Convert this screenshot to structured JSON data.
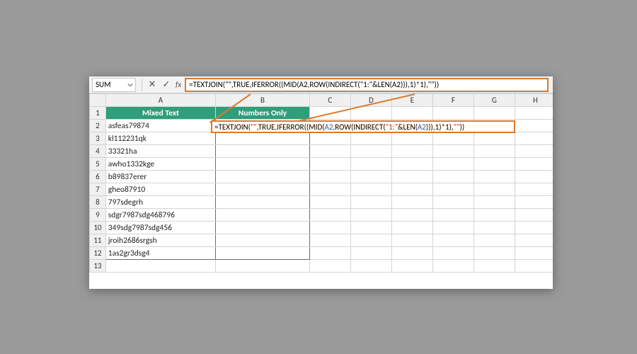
{
  "namebox": {
    "value": "SUM"
  },
  "formula_bar": {
    "cancel_glyph": "✕",
    "enter_glyph": "✓",
    "fx_label": "fx",
    "formula_plain": "=TEXTJOIN(\"\",TRUE,IFERROR((MID(A2,ROW(INDIRECT(\"1:\"&LEN(A2))),1)*1),\"\"))"
  },
  "columns": [
    "A",
    "B",
    "C",
    "D",
    "E",
    "F",
    "G",
    "H"
  ],
  "row_numbers": [
    "1",
    "2",
    "3",
    "4",
    "5",
    "6",
    "7",
    "8",
    "9",
    "10",
    "11",
    "12",
    "13"
  ],
  "headers": {
    "A": "Mixed Text",
    "B": "Numbers Only"
  },
  "col_a": {
    "r2": "asfeas79874",
    "r3": "kl112231qk",
    "r4": "33321ha",
    "r5": "awho1332kge",
    "r6": "b89837erer",
    "r7": "gheo87910",
    "r8": "797sdegrh",
    "r9": "sdgr7987sdg468796",
    "r10": "349sdg7987sdg456",
    "r11": "jroih2686srgsh",
    "r12": "1as2gr3dsg4"
  },
  "cell_edit": {
    "p1": "=TEXTJOIN(",
    "p2": "\"\"",
    "p3": ",TRUE,IFERROR((MID(",
    "p4": "A2",
    "p5": ",ROW(INDIRECT(",
    "p6": "\"1:\"",
    "p7": "&LEN(",
    "p8": "A2",
    "p9": "))),1)*1),",
    "p10": "\"\"",
    "p11": "))"
  }
}
